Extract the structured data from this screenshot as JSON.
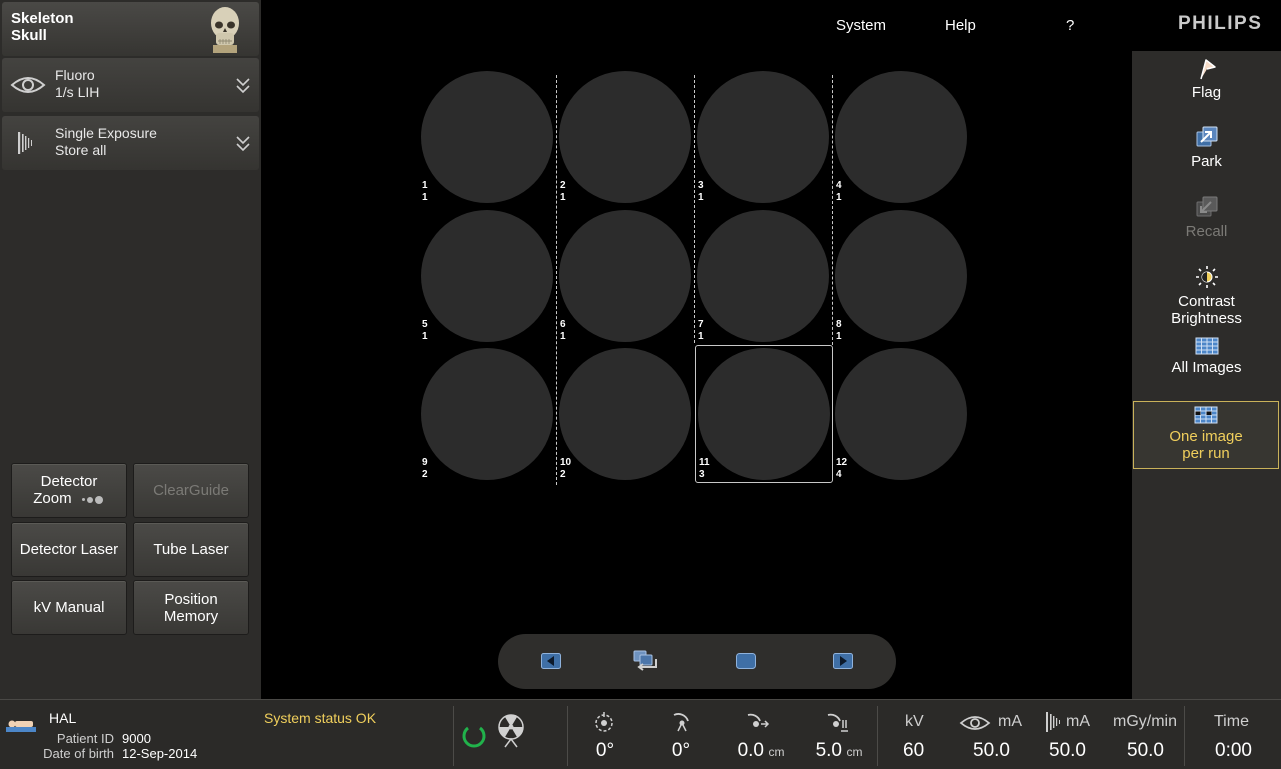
{
  "anatomy": {
    "line1": "Skeleton",
    "line2": "Skull"
  },
  "fluoro": {
    "line1": "Fluoro",
    "line2": "1/s  LIH"
  },
  "exposure": {
    "line1": "Single Exposure",
    "line2": "Store all"
  },
  "buttons": {
    "detector_zoom_1": "Detector",
    "detector_zoom_2": "Zoom",
    "clearguide": "ClearGuide",
    "detector_laser": "Detector Laser",
    "tube_laser": "Tube Laser",
    "kv_manual": "kV Manual",
    "position_memory_1": "Position",
    "position_memory_2": "Memory"
  },
  "menu": {
    "system": "System",
    "help": "Help",
    "question": "?"
  },
  "brand": "PHILIPS",
  "tiles": [
    {
      "num": "1",
      "sub": "1"
    },
    {
      "num": "2",
      "sub": "1"
    },
    {
      "num": "3",
      "sub": "1"
    },
    {
      "num": "4",
      "sub": "1"
    },
    {
      "num": "5",
      "sub": "1"
    },
    {
      "num": "6",
      "sub": "1"
    },
    {
      "num": "7",
      "sub": "1"
    },
    {
      "num": "8",
      "sub": "1"
    },
    {
      "num": "9",
      "sub": "2"
    },
    {
      "num": "10",
      "sub": "2"
    },
    {
      "num": "11",
      "sub": "3"
    },
    {
      "num": "12",
      "sub": "4"
    }
  ],
  "right_panel": {
    "flag": "Flag",
    "park": "Park",
    "recall": "Recall",
    "contrast_1": "Contrast",
    "contrast_2": "Brightness",
    "all_images": "All Images",
    "one_image_1": "One image",
    "one_image_2": "per run"
  },
  "patient": {
    "name": "HAL",
    "id_label": "Patient ID",
    "id_value": "9000",
    "dob_label": "Date of birth",
    "dob_value": "12-Sep-2014"
  },
  "system_status": "System status OK",
  "geometry": {
    "angle1": "0°",
    "angle2": "0°",
    "dist1_value": "0.0",
    "dist1_unit": "cm",
    "dist2_value": "5.0",
    "dist2_unit": "cm"
  },
  "exposure_values": {
    "kv_label": "kV",
    "kv_value": "60",
    "ma_fluoro_label": "mA",
    "ma_fluoro_value": "50.0",
    "ma_exp_label": "mA",
    "ma_exp_value": "50.0",
    "dose_label": "mGy/min",
    "dose_value": "50.0",
    "time_label": "Time",
    "time_value": "0:00"
  },
  "colors": {
    "accent": "#f0cf5c",
    "status_ok": "#21b24b",
    "icon_blue": "#4c86c8"
  }
}
